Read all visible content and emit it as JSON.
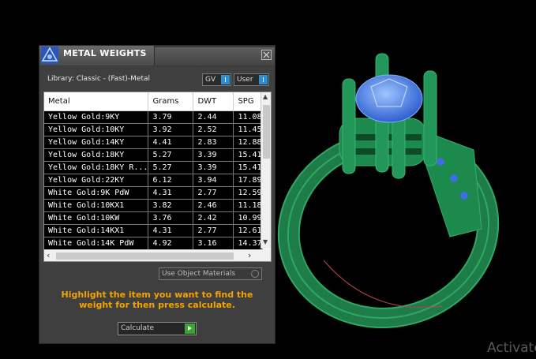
{
  "panel": {
    "title": "METAL WEIGHTS",
    "library_label": "Library: Classic - (Fast)-Metal",
    "dropdown_gv": "GV",
    "dropdown_user": "User"
  },
  "table": {
    "headers": [
      "Metal",
      "Grams",
      "DWT",
      "SPG"
    ],
    "rows": [
      [
        "Yellow Gold:9KY",
        "3.79",
        "2.44",
        "11.08"
      ],
      [
        "Yellow Gold:10KY",
        "3.92",
        "2.52",
        "11.45"
      ],
      [
        "Yellow Gold:14KY",
        "4.41",
        "2.83",
        "12.88"
      ],
      [
        "Yellow Gold:18KY",
        "5.27",
        "3.39",
        "15.41"
      ],
      [
        "Yellow Gold:18KY R...",
        "5.27",
        "3.39",
        "15.41"
      ],
      [
        "Yellow Gold:22KY",
        "6.12",
        "3.94",
        "17.89"
      ],
      [
        "White Gold:9K PdW",
        "4.31",
        "2.77",
        "12.59"
      ],
      [
        "White Gold:10KX1",
        "3.82",
        "2.46",
        "11.18"
      ],
      [
        "White Gold:10KW",
        "3.76",
        "2.42",
        "10.99"
      ],
      [
        "White Gold:14KX1",
        "4.31",
        "2.77",
        "12.61"
      ],
      [
        "White Gold:14K PdW",
        "4.92",
        "3.16",
        "14.37"
      ]
    ]
  },
  "options": {
    "use_object_materials": "Use Object Materials"
  },
  "hint_text": "Highlight the item you want to find the weight for then press calculate.",
  "calculate_label": "Calculate",
  "watermark": "Activate"
}
